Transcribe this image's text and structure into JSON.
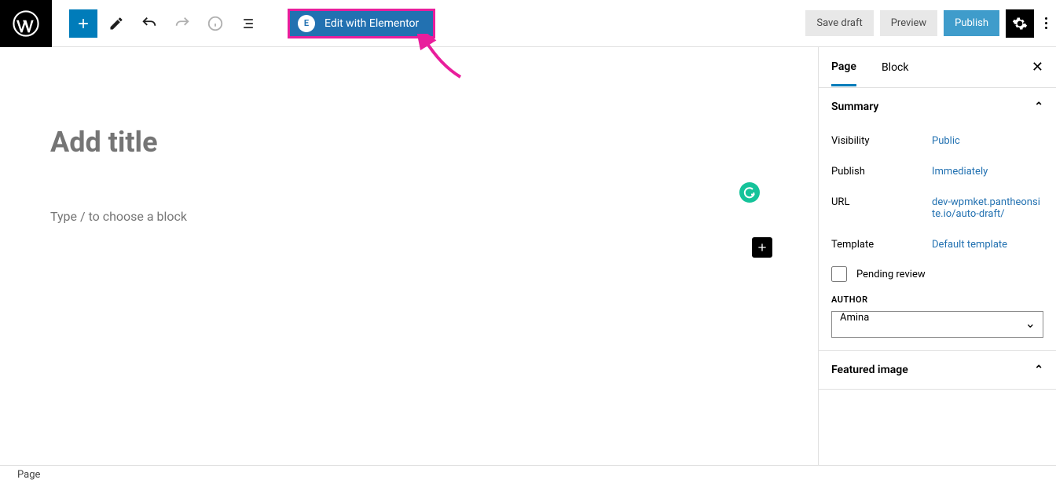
{
  "toolbar": {
    "elementor_label": "Edit with Elementor",
    "save_draft": "Save draft",
    "preview": "Preview",
    "publish": "Publish"
  },
  "editor": {
    "title_placeholder": "Add title",
    "block_placeholder": "Type / to choose a block"
  },
  "sidebar": {
    "tabs": {
      "page": "Page",
      "block": "Block"
    },
    "sections": {
      "summary": {
        "title": "Summary",
        "rows": {
          "visibility": {
            "label": "Visibility",
            "value": "Public"
          },
          "publish": {
            "label": "Publish",
            "value": "Immediately"
          },
          "url": {
            "label": "URL",
            "value": "dev-wpmket.pantheonsite.io/auto-draft/"
          },
          "template": {
            "label": "Template",
            "value": "Default template"
          }
        },
        "pending_review": "Pending review",
        "author_label": "AUTHOR",
        "author_value": "Amina"
      },
      "featured_image": {
        "title": "Featured image"
      }
    }
  },
  "breadcrumb": "Page"
}
